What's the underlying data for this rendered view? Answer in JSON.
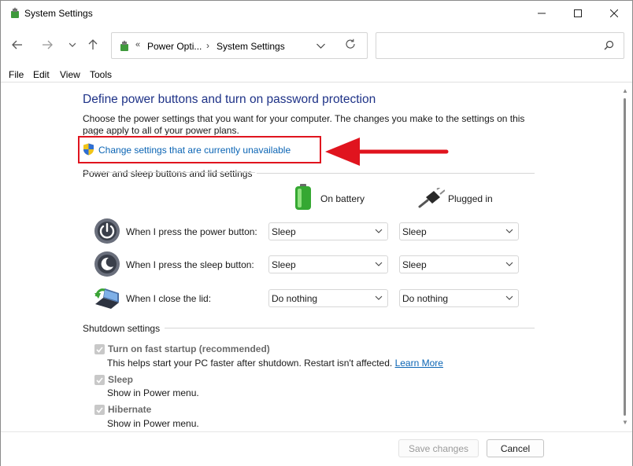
{
  "window": {
    "title": "System Settings"
  },
  "navigation": {
    "back_icon": "arrow-left-icon",
    "forward_icon": "arrow-right-icon",
    "recent_icon": "chevron-down-icon",
    "up_icon": "arrow-up-icon",
    "address": {
      "separator_start": "«",
      "crumb1": "Power Opti...",
      "separator": "›",
      "crumb2": "System Settings"
    },
    "search_placeholder": ""
  },
  "menu": {
    "file": "File",
    "edit": "Edit",
    "view": "View",
    "tools": "Tools"
  },
  "main": {
    "heading": "Define power buttons and turn on password protection",
    "description": "Choose the power settings that you want for your computer. The changes you make to the settings on this page apply to all of your power plans.",
    "change_link": "Change settings that are currently unavailable",
    "power_section": {
      "label": "Power and sleep buttons and lid settings",
      "col_battery": "On battery",
      "col_plugged": "Plugged in",
      "rows": [
        {
          "label": "When I press the power button:",
          "battery": "Sleep",
          "plugged": "Sleep"
        },
        {
          "label": "When I press the sleep button:",
          "battery": "Sleep",
          "plugged": "Sleep"
        },
        {
          "label": "When I close the lid:",
          "battery": "Do nothing",
          "plugged": "Do nothing"
        }
      ]
    },
    "shutdown_section": {
      "label": "Shutdown settings",
      "items": [
        {
          "label": "Turn on fast startup (recommended)",
          "desc": "This helps start your PC faster after shutdown. Restart isn't affected.",
          "link": "Learn More",
          "checked": true
        },
        {
          "label": "Sleep",
          "desc": "Show in Power menu.",
          "checked": true
        },
        {
          "label": "Hibernate",
          "desc": "Show in Power menu.",
          "checked": true
        }
      ]
    }
  },
  "footer": {
    "save": "Save changes",
    "cancel": "Cancel"
  },
  "colors": {
    "heading": "#1e3287",
    "link": "#0a64b4",
    "highlight": "#e0141e"
  }
}
